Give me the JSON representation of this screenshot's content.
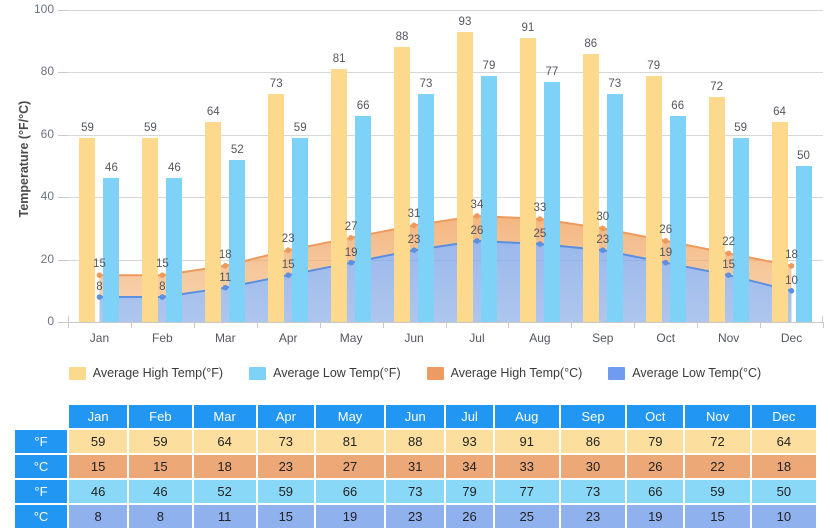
{
  "chart_data": {
    "type": "bar",
    "title": "",
    "xlabel": "",
    "ylabel": "Temperature (°F/°C)",
    "ylim": [
      0,
      100
    ],
    "yticks": [
      0,
      20,
      40,
      60,
      80,
      100
    ],
    "grid": true,
    "legend_position": "bottom",
    "categories": [
      "Jan",
      "Feb",
      "Mar",
      "Apr",
      "May",
      "Jun",
      "Jul",
      "Aug",
      "Sep",
      "Oct",
      "Nov",
      "Dec"
    ],
    "series": [
      {
        "name": "Average High Temp(°F)",
        "type": "bar",
        "color": "#fcd98c",
        "values": [
          59,
          59,
          64,
          73,
          81,
          88,
          93,
          91,
          86,
          79,
          72,
          64
        ]
      },
      {
        "name": "Average Low Temp(°F)",
        "type": "bar",
        "color": "#7ed2f7",
        "values": [
          46,
          46,
          52,
          59,
          66,
          73,
          79,
          77,
          73,
          66,
          59,
          50
        ]
      },
      {
        "name": "Average High Temp(°C)",
        "type": "area",
        "color": "#ef9a5d",
        "values": [
          15,
          15,
          18,
          23,
          27,
          31,
          34,
          33,
          30,
          26,
          22,
          18
        ]
      },
      {
        "name": "Average Low Temp(°C)",
        "type": "area",
        "color": "#6c9ce8",
        "values": [
          8,
          8,
          11,
          15,
          19,
          23,
          26,
          25,
          23,
          19,
          15,
          10
        ]
      }
    ]
  },
  "legend": {
    "items": [
      {
        "label": "Average High Temp(°F)",
        "color": "#fcd98c"
      },
      {
        "label": "Average Low Temp(°F)",
        "color": "#7ed2f7"
      },
      {
        "label": "Average High Temp(°C)",
        "color": "#ed9a63"
      },
      {
        "label": "Average Low Temp(°C)",
        "color": "#6f9bf0"
      }
    ]
  },
  "table": {
    "corner": "",
    "months": [
      "Jan",
      "Feb",
      "Mar",
      "Apr",
      "May",
      "Jun",
      "Jul",
      "Aug",
      "Sep",
      "Oct",
      "Nov",
      "Dec"
    ],
    "rows": [
      {
        "unit": "°F",
        "style": "c-hi-f",
        "values": [
          59,
          59,
          64,
          73,
          81,
          88,
          93,
          91,
          86,
          79,
          72,
          64
        ]
      },
      {
        "unit": "°C",
        "style": "c-hi-c",
        "values": [
          15,
          15,
          18,
          23,
          27,
          31,
          34,
          33,
          30,
          26,
          22,
          18
        ]
      },
      {
        "unit": "°F",
        "style": "c-lo-f",
        "values": [
          46,
          46,
          52,
          59,
          66,
          73,
          79,
          77,
          73,
          66,
          59,
          50
        ]
      },
      {
        "unit": "°C",
        "style": "c-lo-c",
        "values": [
          8,
          8,
          11,
          15,
          19,
          23,
          26,
          25,
          23,
          19,
          15,
          10
        ]
      }
    ]
  }
}
